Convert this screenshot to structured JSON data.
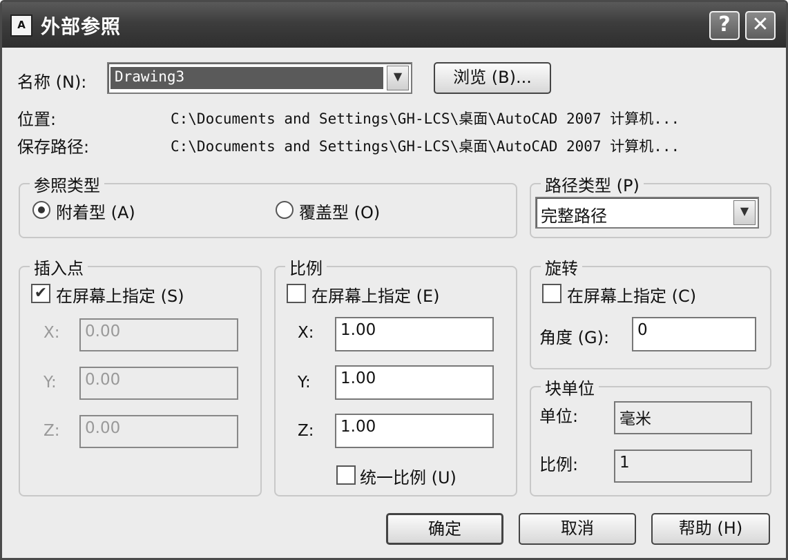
{
  "window": {
    "title": "外部参照",
    "icon_text": "A"
  },
  "name": {
    "label": "名称 (N):",
    "value": "Drawing3",
    "browse_label": "浏览 (B)..."
  },
  "location": {
    "label": "位置:",
    "value": "C:\\Documents and Settings\\GH-LCS\\桌面\\AutoCAD 2007 计算机..."
  },
  "saved_path": {
    "label": "保存路径:",
    "value": "C:\\Documents and Settings\\GH-LCS\\桌面\\AutoCAD 2007 计算机..."
  },
  "reference_type": {
    "title": "参照类型",
    "attachment_label": "附着型 (A)",
    "overlay_label": "覆盖型 (O)",
    "selected": "attachment"
  },
  "path_type": {
    "title": "路径类型 (P)",
    "value": "完整路径"
  },
  "insertion_point": {
    "title": "插入点",
    "specify_label": "在屏幕上指定 (S)",
    "specify_checked": true,
    "x_label": "X:",
    "y_label": "Y:",
    "z_label": "Z:",
    "x": "0.00",
    "y": "0.00",
    "z": "0.00"
  },
  "scale": {
    "title": "比例",
    "specify_label": "在屏幕上指定 (E)",
    "specify_checked": false,
    "x_label": "X:",
    "y_label": "Y:",
    "z_label": "Z:",
    "x": "1.00",
    "y": "1.00",
    "z": "1.00",
    "uniform_label": "统一比例 (U)",
    "uniform_checked": false
  },
  "rotation": {
    "title": "旋转",
    "specify_label": "在屏幕上指定 (C)",
    "specify_checked": false,
    "angle_label": "角度 (G):",
    "angle": "0"
  },
  "block_unit": {
    "title": "块单位",
    "unit_label": "单位:",
    "unit_value": "毫米",
    "factor_label": "比例:",
    "factor_value": "1"
  },
  "buttons": {
    "ok": "确定",
    "cancel": "取消",
    "help": "帮助 (H)"
  },
  "titlebar_buttons": {
    "help": "?",
    "close": "✕"
  },
  "glyphs": {
    "dropdown": "▼",
    "check": "✔"
  }
}
